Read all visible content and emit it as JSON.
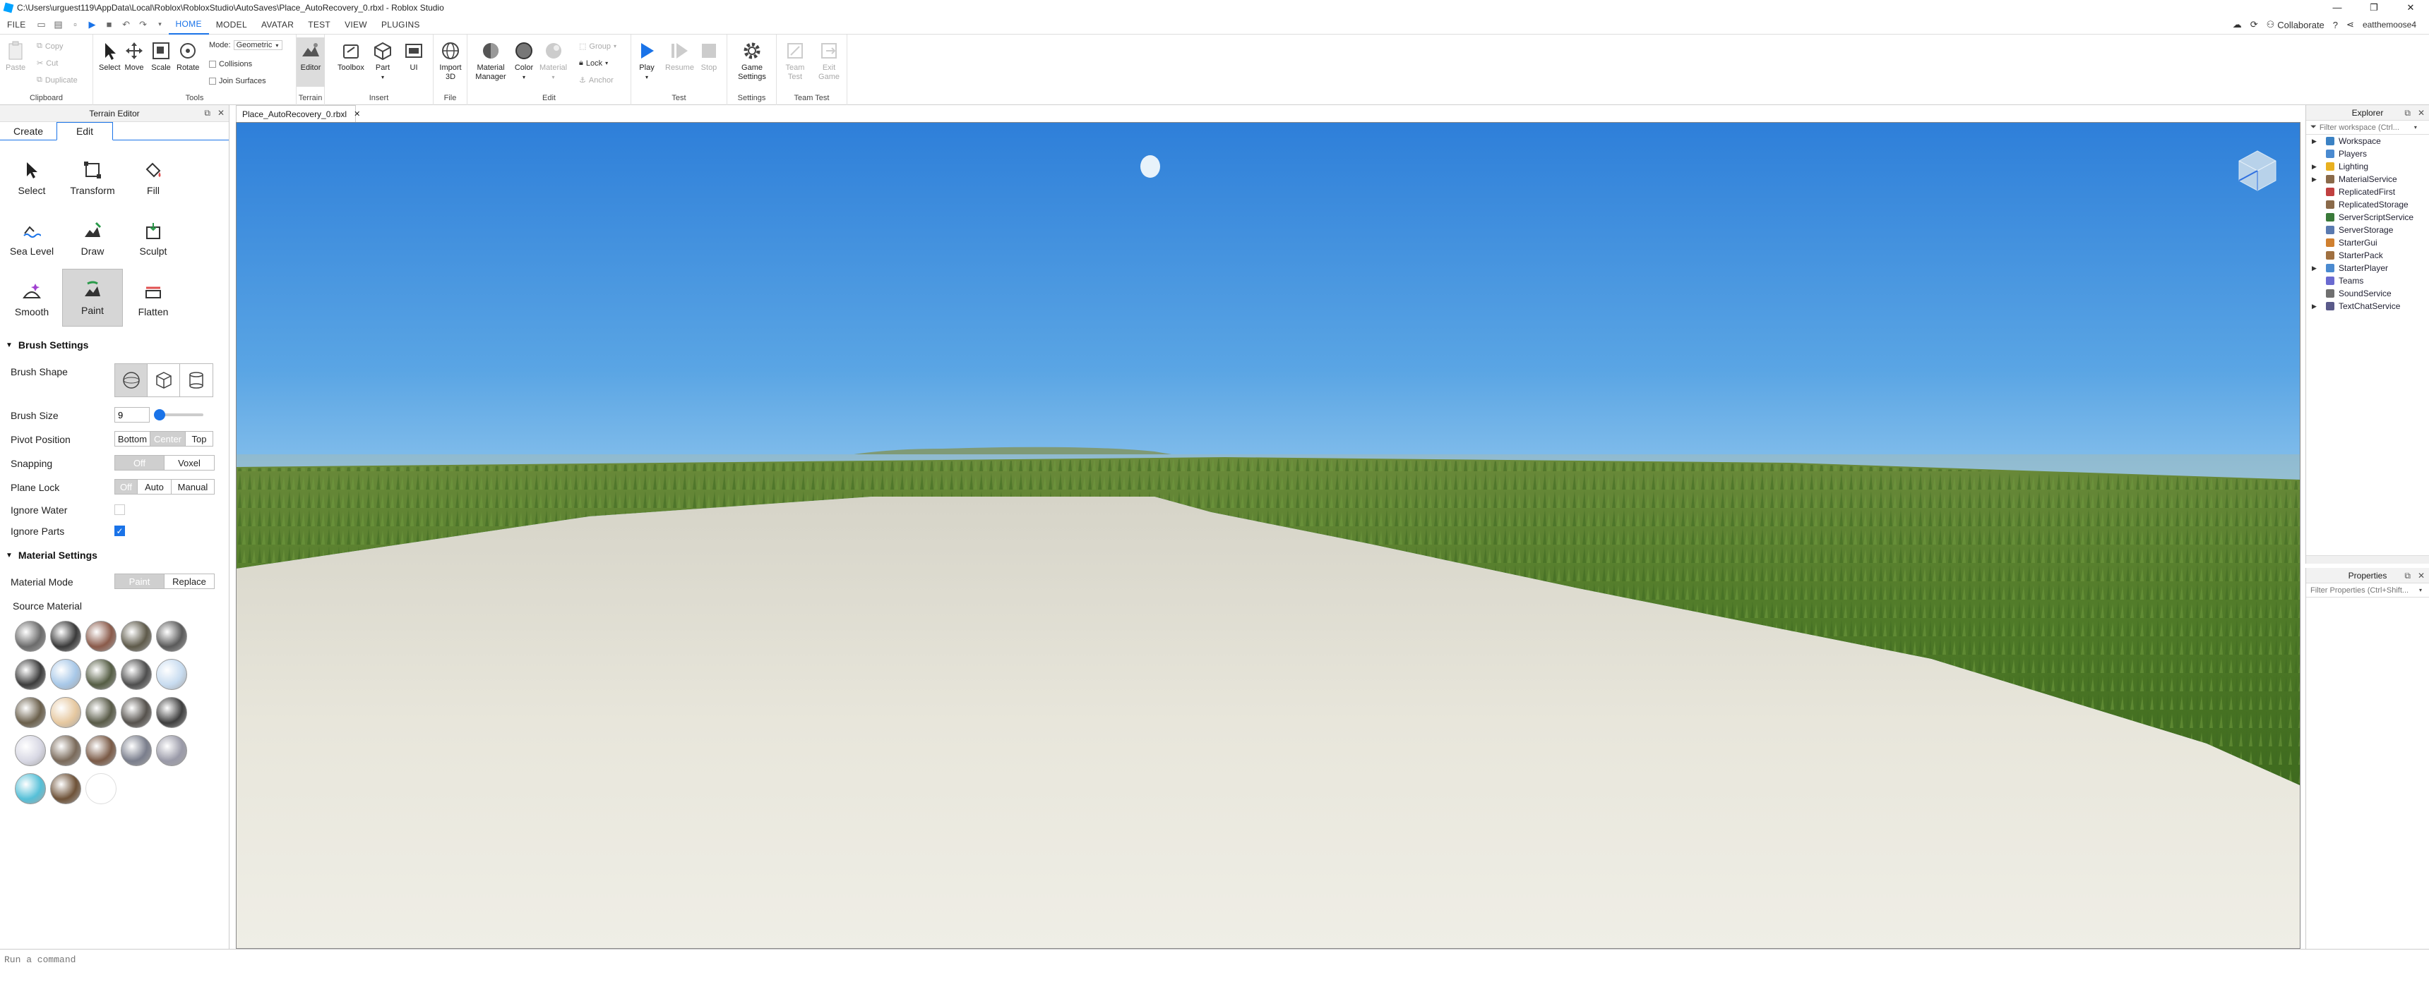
{
  "window": {
    "title": "C:\\Users\\urguest119\\AppData\\Local\\Roblox\\RobloxStudio\\AutoSaves\\Place_AutoRecovery_0.rbxl - Roblox Studio"
  },
  "menu": {
    "tabs": [
      "FILE",
      "HOME",
      "MODEL",
      "AVATAR",
      "TEST",
      "VIEW",
      "PLUGINS"
    ],
    "active_tab": "HOME",
    "collaborate": "Collaborate",
    "username": "eatthemoose4"
  },
  "ribbon": {
    "clipboard": {
      "label": "Clipboard",
      "paste": "Paste",
      "copy": "Copy",
      "cut": "Cut",
      "duplicate": "Duplicate"
    },
    "tools": {
      "label": "Tools",
      "select": "Select",
      "move": "Move",
      "scale": "Scale",
      "rotate": "Rotate",
      "mode_label": "Mode:",
      "mode_value": "Geometric",
      "collisions": "Collisions",
      "join_surfaces": "Join Surfaces"
    },
    "terrain": {
      "label": "Terrain",
      "editor": "Editor"
    },
    "insert": {
      "label": "Insert",
      "toolbox": "Toolbox",
      "part": "Part",
      "ui": "UI"
    },
    "file": {
      "label": "File",
      "import3d": "Import 3D"
    },
    "edit": {
      "label": "Edit",
      "material_manager": "Material Manager",
      "color": "Color",
      "material": "Material",
      "group": "Group",
      "lock": "Lock",
      "anchor": "Anchor"
    },
    "test": {
      "label": "Test",
      "play": "Play",
      "resume": "Resume",
      "stop": "Stop"
    },
    "settings": {
      "label": "Settings",
      "game_settings": "Game Settings"
    },
    "team_test": {
      "label": "Team Test",
      "team_test": "Team Test",
      "exit_game": "Exit Game"
    }
  },
  "terrain_editor": {
    "title": "Terrain Editor",
    "tabs": [
      "Create",
      "Edit"
    ],
    "active_tab": "Edit",
    "tools": [
      "Select",
      "Transform",
      "Fill",
      "Sea Level",
      "Draw",
      "Sculpt",
      "Smooth",
      "Paint",
      "Flatten"
    ],
    "active_tool": "Paint",
    "brush_settings": {
      "heading": "Brush Settings",
      "brush_shape": "Brush Shape",
      "brush_size": "Brush Size",
      "brush_size_value": "9",
      "brush_size_fraction": 0.06,
      "pivot_position": "Pivot Position",
      "pivot_options": [
        "Bottom",
        "Center",
        "Top"
      ],
      "pivot_selected": "Center",
      "snapping": "Snapping",
      "snapping_options": [
        "Off",
        "Voxel"
      ],
      "snapping_selected": "Off",
      "plane_lock": "Plane Lock",
      "plane_lock_options": [
        "Off",
        "Auto",
        "Manual"
      ],
      "plane_lock_selected": "Off",
      "ignore_water": "Ignore Water",
      "ignore_water_checked": false,
      "ignore_parts": "Ignore Parts",
      "ignore_parts_checked": true
    },
    "material_settings": {
      "heading": "Material Settings",
      "material_mode": "Material Mode",
      "mode_options": [
        "Paint",
        "Replace"
      ],
      "mode_selected": "Paint",
      "source_material": "Source Material",
      "swatch_colors": [
        "#6b6b6b",
        "#3a3a3a",
        "#8a5a4a",
        "#5e5a4a",
        "#5a5a5a",
        "#3c3c3c",
        "#a8c8e8",
        "#555d44",
        "#4e4e4e",
        "#c8dcf0",
        "#6b604c",
        "#e6c8a0",
        "#595b48",
        "#56524d",
        "#3e3e3e",
        "#d8d8e4",
        "#7a6a5a",
        "#7a5a46",
        "#7a7e8c",
        "#9a9aa8",
        "#56c0d8",
        "#6e5238",
        "#ffffff"
      ]
    }
  },
  "document_tab": {
    "label": "Place_AutoRecovery_0.rbxl"
  },
  "explorer": {
    "title": "Explorer",
    "filter_placeholder": "Filter workspace (Ctrl...",
    "items": [
      {
        "label": "Workspace",
        "color": "#3b82c4",
        "expandable": true
      },
      {
        "label": "Players",
        "color": "#4a8ad0",
        "expandable": false
      },
      {
        "label": "Lighting",
        "color": "#e8b020",
        "expandable": true
      },
      {
        "label": "MaterialService",
        "color": "#8a6a4a",
        "expandable": true
      },
      {
        "label": "ReplicatedFirst",
        "color": "#c04040",
        "expandable": false
      },
      {
        "label": "ReplicatedStorage",
        "color": "#8a6a4a",
        "expandable": false
      },
      {
        "label": "ServerScriptService",
        "color": "#3a7a3a",
        "expandable": false
      },
      {
        "label": "ServerStorage",
        "color": "#5a7ab0",
        "expandable": false
      },
      {
        "label": "StarterGui",
        "color": "#d08030",
        "expandable": false
      },
      {
        "label": "StarterPack",
        "color": "#a07040",
        "expandable": false
      },
      {
        "label": "StarterPlayer",
        "color": "#4a8ad0",
        "expandable": true
      },
      {
        "label": "Teams",
        "color": "#6a6ad0",
        "expandable": false
      },
      {
        "label": "SoundService",
        "color": "#707070",
        "expandable": false
      },
      {
        "label": "TextChatService",
        "color": "#5a5a8a",
        "expandable": true
      }
    ]
  },
  "properties": {
    "title": "Properties",
    "filter_placeholder": "Filter Properties (Ctrl+Shift..."
  },
  "command_bar": {
    "placeholder": "Run a command"
  }
}
